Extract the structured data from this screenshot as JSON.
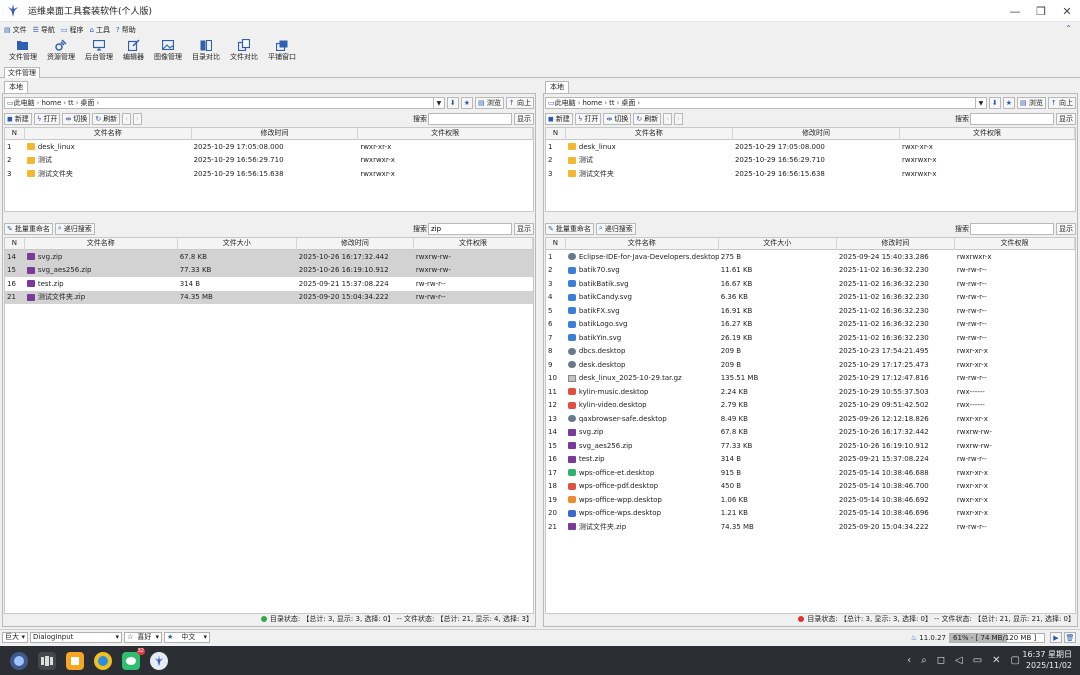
{
  "app": {
    "title": "运维桌面工具套装软件(个人版)"
  },
  "menu": [
    {
      "icon": "file-icon",
      "label": "文件"
    },
    {
      "icon": "nav-icon",
      "label": "导航"
    },
    {
      "icon": "program-icon",
      "label": "程序"
    },
    {
      "icon": "tools-icon",
      "label": "工具"
    },
    {
      "icon": "help-icon",
      "label": "帮助"
    }
  ],
  "toolbar": [
    {
      "name": "file-manager",
      "label": "文件管理"
    },
    {
      "name": "resource-manager",
      "label": "资源管理"
    },
    {
      "name": "backend-manager",
      "label": "后台管理"
    },
    {
      "name": "editor",
      "label": "编辑器"
    },
    {
      "name": "image-manager",
      "label": "图像管理"
    },
    {
      "name": "dir-compare",
      "label": "目录对比"
    },
    {
      "name": "file-compare",
      "label": "文件对比"
    },
    {
      "name": "tile-window",
      "label": "平铺窗口"
    }
  ],
  "module_tab": "文件管理",
  "left": {
    "tab": "本地",
    "path": [
      "此电脑",
      "home",
      "tt",
      "桌面"
    ],
    "buttons": {
      "browse": "浏览",
      "up": "向上",
      "new": "新建",
      "open": "打开",
      "switch": "切换",
      "refresh": "刷新"
    },
    "search_label": "搜索",
    "search_value": "",
    "show_label": "显示",
    "top_columns": [
      "N",
      "文件名称",
      "修改时间",
      "文件权限"
    ],
    "top_rows": [
      {
        "n": "1",
        "icon": "folder",
        "name": "desk_linux",
        "mtime": "2025-10-29 17:05:08.000",
        "perm": "rwxr-xr-x"
      },
      {
        "n": "2",
        "icon": "folder",
        "name": "测试",
        "mtime": "2025-10-29 16:56:29.710",
        "perm": "rwxrwxr-x"
      },
      {
        "n": "3",
        "icon": "folder",
        "name": "测试文件夹",
        "mtime": "2025-10-29 16:56:15.638",
        "perm": "rwxrwxr-x"
      }
    ],
    "bottom_buttons": {
      "rename": "批量重命名",
      "recursive": "递归搜索"
    },
    "bottom_search_value": "zip",
    "bottom_columns": [
      "N",
      "文件名称",
      "文件大小",
      "修改时间",
      "文件权限"
    ],
    "bottom_rows": [
      {
        "n": "14",
        "icon": "zip",
        "name": "svg.zip",
        "size": "67.8 KB",
        "mtime": "2025-10-26 16:17:32.442",
        "perm": "rwxrw-rw-",
        "sel": true
      },
      {
        "n": "15",
        "icon": "zip",
        "name": "svg_aes256.zip",
        "size": "77.33 KB",
        "mtime": "2025-10-26 16:19:10.912",
        "perm": "rwxrw-rw-",
        "sel": true
      },
      {
        "n": "16",
        "icon": "zip",
        "name": "test.zip",
        "size": "314 B",
        "mtime": "2025-09-21 15:37:08.224",
        "perm": "rw-rw-r--",
        "sel": false
      },
      {
        "n": "21",
        "icon": "zip",
        "name": "测试文件夹.zip",
        "size": "74.35 MB",
        "mtime": "2025-09-20 15:04:34.222",
        "perm": "rw-rw-r--",
        "sel": true
      }
    ],
    "status": {
      "dot_color": "#2fa84a",
      "text": "目录状态: 【总计: 3, 显示: 3, 选择: 0】 -- 文件状态: 【总计: 21, 显示: 4, 选择: 3】"
    }
  },
  "right": {
    "tab": "本地",
    "path": [
      "此电脑",
      "home",
      "tt",
      "桌面"
    ],
    "buttons": {
      "browse": "浏览",
      "up": "向上",
      "new": "新建",
      "open": "打开",
      "switch": "切换",
      "refresh": "刷新"
    },
    "search_label": "搜索",
    "search_value": "",
    "show_label": "显示",
    "top_columns": [
      "N",
      "文件名称",
      "修改时间",
      "文件权限"
    ],
    "top_rows": [
      {
        "n": "1",
        "icon": "folder",
        "name": "desk_linux",
        "mtime": "2025-10-29 17:05:08.000",
        "perm": "rwxr-xr-x"
      },
      {
        "n": "2",
        "icon": "folder",
        "name": "测试",
        "mtime": "2025-10-29 16:56:29.710",
        "perm": "rwxrwxr-x"
      },
      {
        "n": "3",
        "icon": "folder",
        "name": "测试文件夹",
        "mtime": "2025-10-29 16:56:15.638",
        "perm": "rwxrwxr-x"
      }
    ],
    "bottom_buttons": {
      "rename": "批量重命名",
      "recursive": "递归搜索"
    },
    "bottom_search_value": "",
    "bottom_columns": [
      "N",
      "文件名称",
      "文件大小",
      "修改时间",
      "文件权限"
    ],
    "bottom_rows": [
      {
        "n": "1",
        "icon": "desk",
        "name": "Eclipse-IDE-for-Java-Developers.desktop",
        "size": "275 B",
        "mtime": "2025-09-24 15:40:33.286",
        "perm": "rwxrwxr-x"
      },
      {
        "n": "2",
        "icon": "svg",
        "name": "batik70.svg",
        "size": "11.61 KB",
        "mtime": "2025-11-02 16:36:32.230",
        "perm": "rw-rw-r--"
      },
      {
        "n": "3",
        "icon": "svg",
        "name": "batikBatik.svg",
        "size": "16.67 KB",
        "mtime": "2025-11-02 16:36:32.230",
        "perm": "rw-rw-r--"
      },
      {
        "n": "4",
        "icon": "svg",
        "name": "batikCandy.svg",
        "size": "6.36 KB",
        "mtime": "2025-11-02 16:36:32.230",
        "perm": "rw-rw-r--"
      },
      {
        "n": "5",
        "icon": "svg",
        "name": "batikFX.svg",
        "size": "16.91 KB",
        "mtime": "2025-11-02 16:36:32.230",
        "perm": "rw-rw-r--"
      },
      {
        "n": "6",
        "icon": "svg",
        "name": "batikLogo.svg",
        "size": "16.27 KB",
        "mtime": "2025-11-02 16:36:32.230",
        "perm": "rw-rw-r--"
      },
      {
        "n": "7",
        "icon": "svg",
        "name": "batikYin.svg",
        "size": "26.19 KB",
        "mtime": "2025-11-02 16:36:32.230",
        "perm": "rw-rw-r--"
      },
      {
        "n": "8",
        "icon": "desk",
        "name": "dbcs.desktop",
        "size": "209 B",
        "mtime": "2025-10-23 17:54:21.495",
        "perm": "rwxr-xr-x"
      },
      {
        "n": "9",
        "icon": "desk",
        "name": "desk.desktop",
        "size": "209 B",
        "mtime": "2025-10-29 17:17:25.473",
        "perm": "rwxr-xr-x"
      },
      {
        "n": "10",
        "icon": "tgz",
        "name": "desk_linux_2025-10-29.tar.gz",
        "size": "135.51 MB",
        "mtime": "2025-10-29 17:12:47.816",
        "perm": "rw-rw-r--"
      },
      {
        "n": "11",
        "icon": "red",
        "name": "kylin-music.desktop",
        "size": "2.24 KB",
        "mtime": "2025-10-29 10:55:37.503",
        "perm": "rwx------"
      },
      {
        "n": "12",
        "icon": "red",
        "name": "kylin-video.desktop",
        "size": "2.79 KB",
        "mtime": "2025-10-29 09:51:42.502",
        "perm": "rwx------"
      },
      {
        "n": "13",
        "icon": "desk",
        "name": "qaxbrowser-safe.desktop",
        "size": "8.49 KB",
        "mtime": "2025-09-26 12:12:18.826",
        "perm": "rwxr-xr-x"
      },
      {
        "n": "14",
        "icon": "zip",
        "name": "svg.zip",
        "size": "67.8 KB",
        "mtime": "2025-10-26 16:17:32.442",
        "perm": "rwxrw-rw-"
      },
      {
        "n": "15",
        "icon": "zip",
        "name": "svg_aes256.zip",
        "size": "77.33 KB",
        "mtime": "2025-10-26 16:19:10.912",
        "perm": "rwxrw-rw-"
      },
      {
        "n": "16",
        "icon": "zip",
        "name": "test.zip",
        "size": "314 B",
        "mtime": "2025-09-21 15:37:08.224",
        "perm": "rw-rw-r--"
      },
      {
        "n": "17",
        "icon": "green",
        "name": "wps-office-et.desktop",
        "size": "915 B",
        "mtime": "2025-05-14 10:38:46.688",
        "perm": "rwxr-xr-x"
      },
      {
        "n": "18",
        "icon": "red",
        "name": "wps-office-pdf.desktop",
        "size": "450 B",
        "mtime": "2025-05-14 10:38:46.700",
        "perm": "rwxr-xr-x"
      },
      {
        "n": "19",
        "icon": "orange",
        "name": "wps-office-wpp.desktop",
        "size": "1.06 KB",
        "mtime": "2025-05-14 10:38:46.692",
        "perm": "rwxr-xr-x"
      },
      {
        "n": "20",
        "icon": "blue2",
        "name": "wps-office-wps.desktop",
        "size": "1.21 KB",
        "mtime": "2025-05-14 10:38:46.696",
        "perm": "rwxr-xr-x"
      },
      {
        "n": "21",
        "icon": "zip",
        "name": "测试文件夹.zip",
        "size": "74.35 MB",
        "mtime": "2025-09-20 15:04:34.222",
        "perm": "rw-rw-r--"
      }
    ],
    "status": {
      "dot_color": "#e0332b",
      "text": "目录状态: 【总计: 3, 显示: 3, 选择: 0】 -- 文件状态: 【总计: 21, 显示: 21, 选择: 0】"
    }
  },
  "bottombar": {
    "font_size": "巨大",
    "component": "DialogInput",
    "favorite": "喜好",
    "language": "中文",
    "version": "11.0.27",
    "memory_text": "61% - [ 74 MB/120 MB ]",
    "memory_percent": 61
  },
  "taskbar": {
    "badge_count": "32",
    "time": "16:37 星期日",
    "date": "2025/11/02"
  }
}
